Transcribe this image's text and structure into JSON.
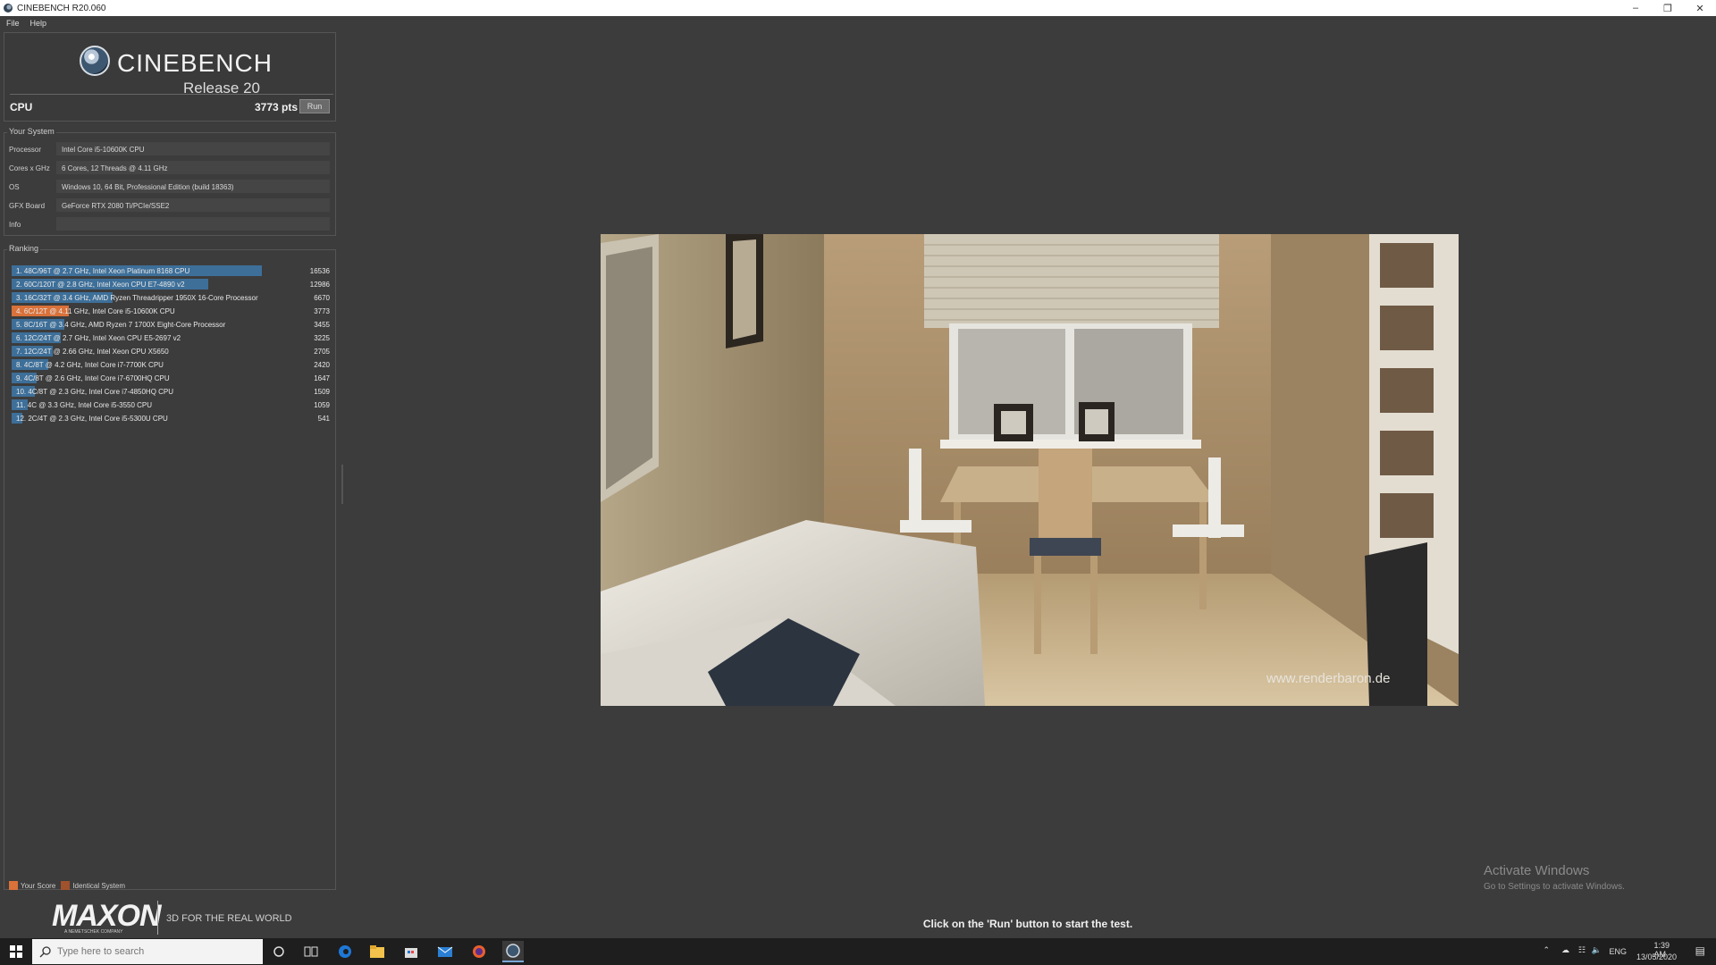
{
  "window": {
    "title": "CINEBENCH R20.060"
  },
  "menu": [
    "File",
    "Help"
  ],
  "header": {
    "brand": "CINEBENCH",
    "release": "Release 20",
    "cpu_label": "CPU",
    "cpu_score": "3773 pts",
    "run_label": "Run"
  },
  "system": {
    "title": "Your System",
    "rows": [
      {
        "key": "Processor",
        "value": "Intel Core i5-10600K CPU"
      },
      {
        "key": "Cores x GHz",
        "value": "6 Cores, 12 Threads @ 4.11 GHz"
      },
      {
        "key": "OS",
        "value": "Windows 10, 64 Bit, Professional Edition (build 18363)"
      },
      {
        "key": "GFX Board",
        "value": "GeForce RTX 2080 Ti/PCIe/SSE2"
      },
      {
        "key": "Info",
        "value": ""
      }
    ]
  },
  "ranking": {
    "title": "Ranking",
    "max": 16536,
    "items": [
      {
        "label": "1. 48C/96T @ 2.7 GHz, Intel Xeon Platinum 8168 CPU",
        "score": 16536,
        "kind": "other"
      },
      {
        "label": "2. 60C/120T @ 2.8 GHz, Intel Xeon CPU E7-4890 v2",
        "score": 12986,
        "kind": "other"
      },
      {
        "label": "3. 16C/32T @ 3.4 GHz, AMD Ryzen Threadripper 1950X 16-Core Processor",
        "score": 6670,
        "kind": "other"
      },
      {
        "label": "4. 6C/12T @ 4.11 GHz, Intel Core i5-10600K CPU",
        "score": 3773,
        "kind": "yours"
      },
      {
        "label": "5. 8C/16T @ 3.4 GHz, AMD Ryzen 7 1700X Eight-Core Processor",
        "score": 3455,
        "kind": "other"
      },
      {
        "label": "6. 12C/24T @ 2.7 GHz, Intel Xeon CPU E5-2697 v2",
        "score": 3225,
        "kind": "other"
      },
      {
        "label": "7. 12C/24T @ 2.66 GHz, Intel Xeon CPU X5650",
        "score": 2705,
        "kind": "other"
      },
      {
        "label": "8. 4C/8T @ 4.2 GHz, Intel Core i7-7700K CPU",
        "score": 2420,
        "kind": "other"
      },
      {
        "label": "9. 4C/8T @ 2.6 GHz, Intel Core i7-6700HQ CPU",
        "score": 1647,
        "kind": "other"
      },
      {
        "label": "10. 4C/8T @ 2.3 GHz, Intel Core i7-4850HQ CPU",
        "score": 1509,
        "kind": "other"
      },
      {
        "label": "11. 4C @ 3.3 GHz, Intel Core i5-3550 CPU",
        "score": 1059,
        "kind": "other"
      },
      {
        "label": "12. 2C/4T @ 2.3 GHz, Intel Core i5-5300U CPU",
        "score": 541,
        "kind": "other"
      }
    ]
  },
  "legend": {
    "your_score": "Your Score",
    "identical": "Identical System"
  },
  "colors": {
    "bar_other": "#3d6f99",
    "bar_yours": "#d9713a",
    "identical": "#a0522d",
    "panel": "#3a3a3a"
  },
  "footer": {
    "maxon": "MAXON",
    "maxon_sub": "A NEMETSCHEK COMPANY",
    "tagline": "3D FOR THE REAL WORLD"
  },
  "render": {
    "credit": "www.renderbaron.de"
  },
  "status": "Click on the 'Run' button to start the test.",
  "activation": {
    "line1": "Activate Windows",
    "line2": "Go to Settings to activate Windows."
  },
  "taskbar": {
    "search_placeholder": "Type here to search",
    "lang": "ENG",
    "time": "1:39 AM",
    "date": "13/05/2020"
  }
}
